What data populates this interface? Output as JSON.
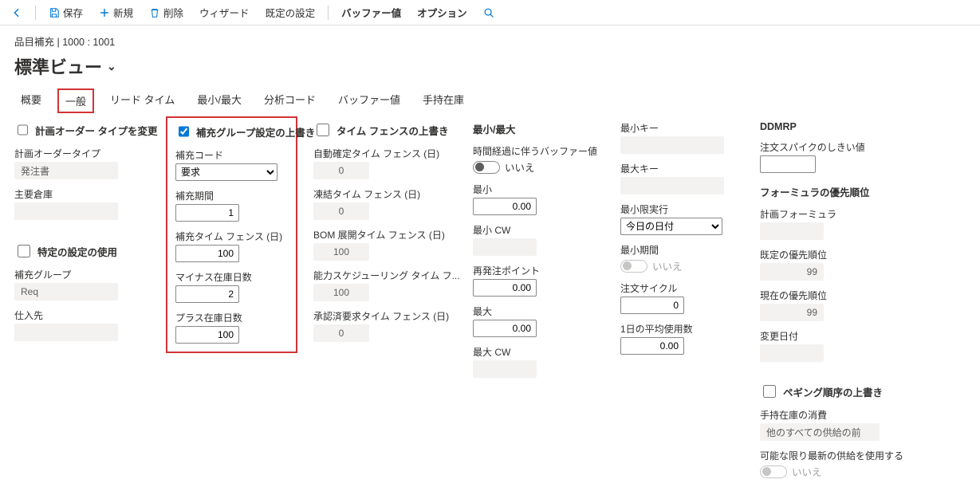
{
  "toolbar": {
    "save": "保存",
    "new": "新規",
    "delete": "削除",
    "wizard": "ウィザード",
    "default_settings": "既定の設定",
    "buffer_values": "バッファー値",
    "options": "オプション"
  },
  "header": {
    "breadcrumb": "品目補充   |   1000 : 1001",
    "title": "標準ビュー"
  },
  "tabs": {
    "overview": "概要",
    "general": "一般",
    "leadtime": "リード タイム",
    "minmax": "最小/最大",
    "analysis": "分析コード",
    "buffer": "バッファー値",
    "onhand": "手持在庫"
  },
  "col1": {
    "override_plan_order_type": "計画オーダー タイプを変更",
    "plan_order_type_label": "計画オーダータイプ",
    "plan_order_type_value": "発注書",
    "primary_warehouse_label": "主要倉庫",
    "primary_warehouse_value": "",
    "use_specific_settings": "特定の設定の使用",
    "replen_group_label": "補充グループ",
    "replen_group_value": "Req",
    "vendor_label": "仕入先",
    "vendor_value": ""
  },
  "col2": {
    "override_group_settings": "補充グループ設定の上書き",
    "replen_code_label": "補充コード",
    "replen_code_value": "要求",
    "replen_period_label": "補充期間",
    "replen_period_value": "1",
    "replen_time_fence_label": "補充タイム フェンス (日)",
    "replen_time_fence_value": "100",
    "negative_days_label": "マイナス在庫日数",
    "negative_days_value": "2",
    "positive_days_label": "プラス在庫日数",
    "positive_days_value": "100"
  },
  "col3": {
    "override_time_fence": "タイム フェンスの上書き",
    "auto_firm_tf_label": "自動確定タイム フェンス (日)",
    "auto_firm_tf_value": "0",
    "freeze_tf_label": "凍結タイム フェンス (日)",
    "freeze_tf_value": "0",
    "bom_explode_tf_label": "BOM 展開タイム フェンス (日)",
    "bom_explode_tf_value": "100",
    "capacity_tf_label": "能力スケジューリング タイム フ...",
    "capacity_tf_value": "100",
    "approved_req_tf_label": "承認済要求タイム フェンス (日)",
    "approved_req_tf_value": "0"
  },
  "col4": {
    "heading": "最小/最大",
    "buffer_over_time_label": "時間経過に伴うバッファー値",
    "buffer_over_time_value": "いいえ",
    "min_label": "最小",
    "min_value": "0.00",
    "min_cw_label": "最小 CW",
    "min_cw_value": "",
    "reorder_point_label": "再発注ポイント",
    "reorder_point_value": "0.00",
    "max_label": "最大",
    "max_value": "0.00",
    "max_cw_label": "最大 CW",
    "max_cw_value": ""
  },
  "col5": {
    "min_key_label": "最小キー",
    "min_key_value": "",
    "max_key_label": "最大キー",
    "max_key_value": "",
    "min_execution_label": "最小限実行",
    "min_execution_value": "今日の日付",
    "min_period_label": "最小期間",
    "min_period_value": "いいえ",
    "order_cycle_label": "注文サイクル",
    "order_cycle_value": "0",
    "avg_daily_usage_label": "1日の平均使用数",
    "avg_daily_usage_value": "0.00"
  },
  "col6": {
    "heading": "DDMRP",
    "order_spike_threshold_label": "注文スパイクのしきい値",
    "order_spike_threshold_value": "",
    "formula_priority_heading": "フォーミュラの優先順位",
    "plan_formula_label": "計画フォーミュラ",
    "plan_formula_value": "",
    "default_priority_label": "既定の優先順位",
    "default_priority_value": "99",
    "current_priority_label": "現在の優先順位",
    "current_priority_value": "99",
    "change_date_label": "変更日付",
    "change_date_value": "",
    "override_pegging": "ペギング順序の上書き",
    "onhand_consumption_label": "手持在庫の消費",
    "onhand_consumption_value": "他のすべての供給の前",
    "use_latest_supply_label": "可能な限り最新の供給を使用する",
    "use_latest_supply_value": "いいえ"
  }
}
